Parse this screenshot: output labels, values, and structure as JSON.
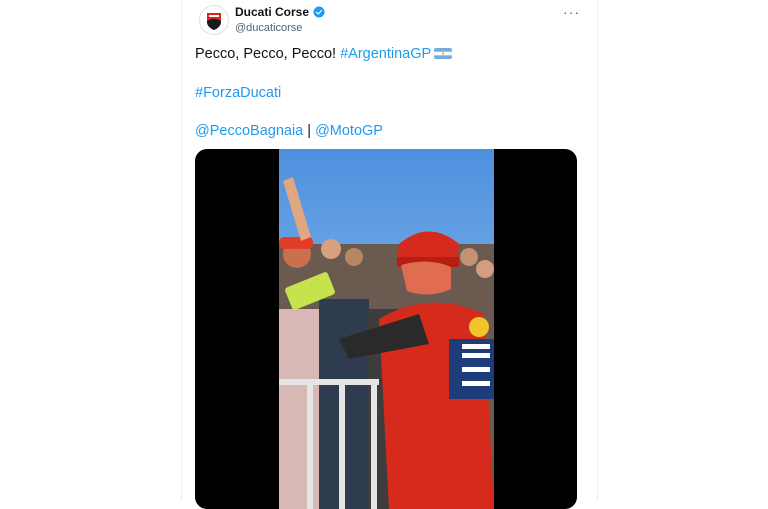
{
  "tweet": {
    "display_name": "Ducati Corse",
    "handle": "@ducaticorse",
    "more_icon": "···",
    "line1_text": "Pecco, Pecco, Pecco! ",
    "line1_hashtag": "#ArgentinaGP",
    "line2_hashtag": "#ForzaDucati",
    "mention1": "@PeccoBagnaia",
    "separator": " | ",
    "mention2": "@MotoGP"
  },
  "icons": {
    "avatar": "ducati-logo-icon",
    "verified": "verified-badge-icon",
    "flag": "argentina-flag-icon",
    "more": "more-options-icon"
  },
  "colors": {
    "link": "#1d9bf0",
    "text": "#0f1419",
    "secondary": "#536471",
    "ducati_red": "#d5281d"
  }
}
